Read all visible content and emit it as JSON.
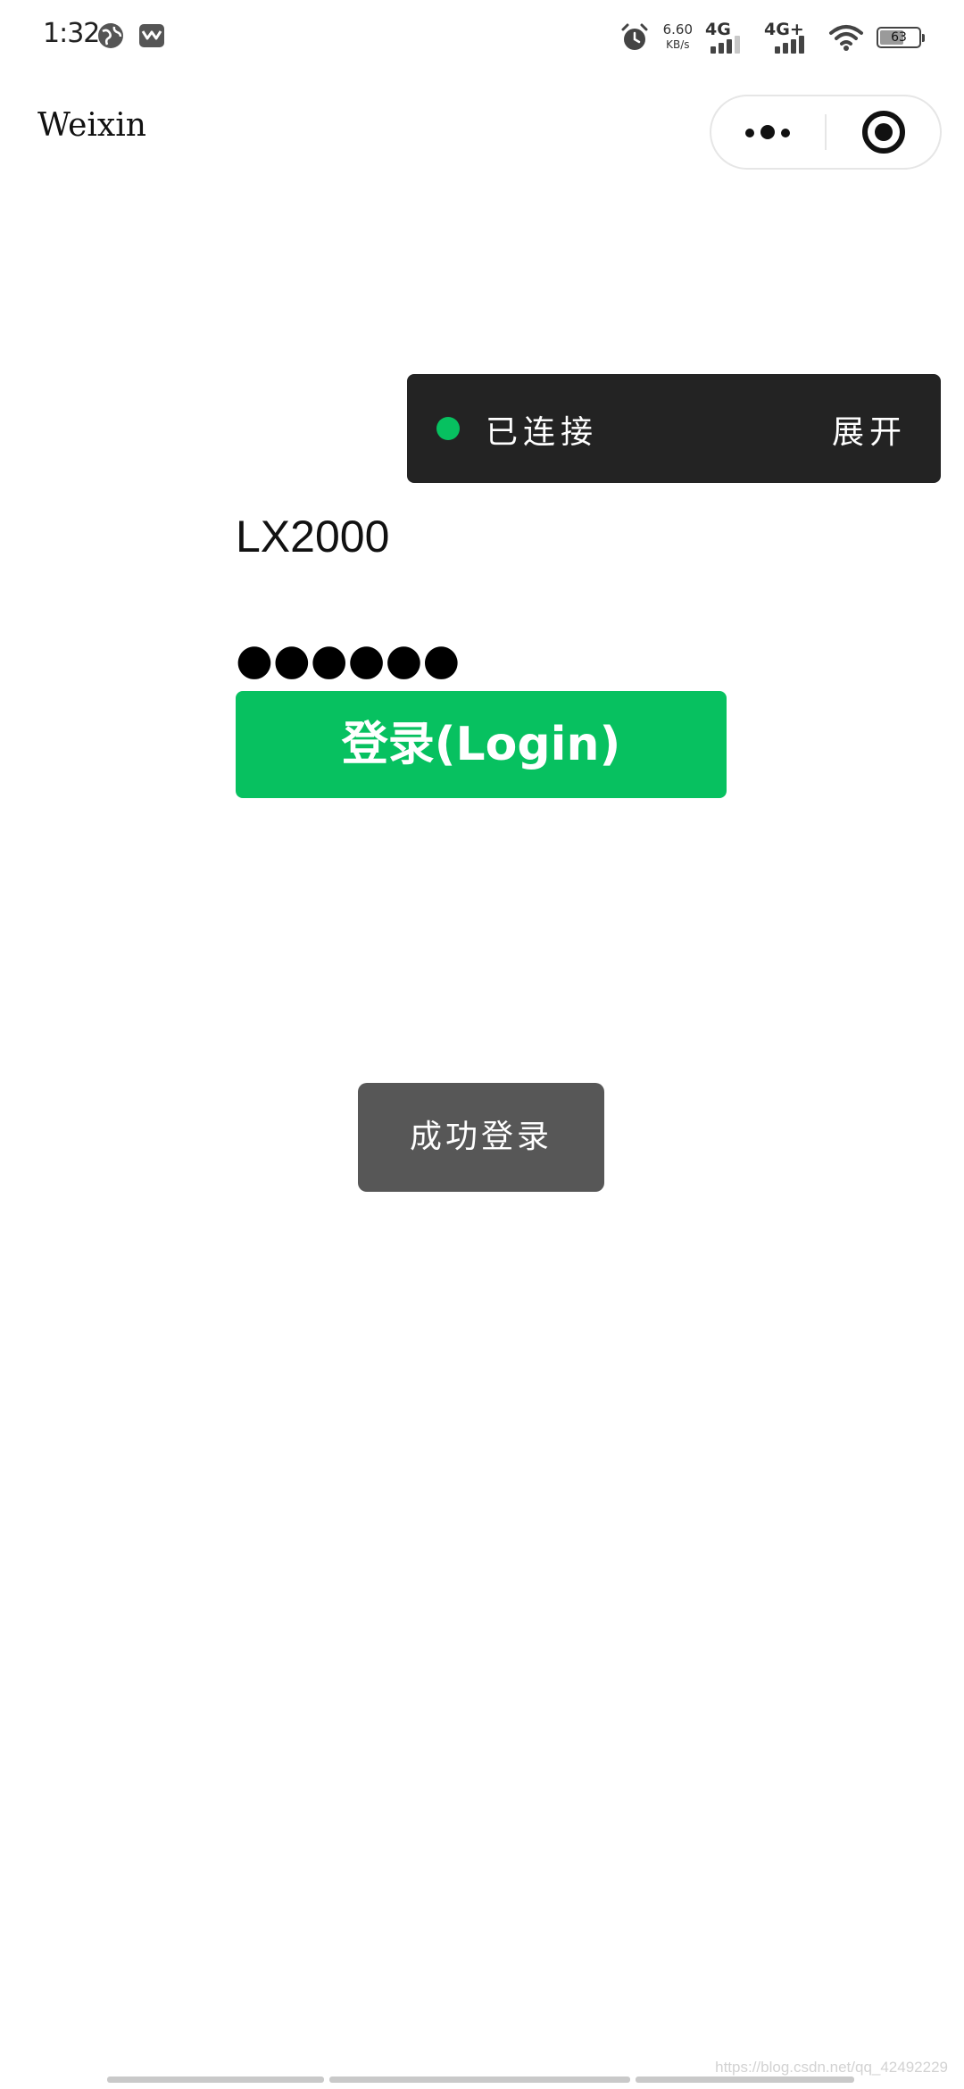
{
  "status_bar": {
    "time": "1:32",
    "app_icons": [
      "globe-icon",
      "mail-icon"
    ],
    "net_speed_value": "6.60",
    "net_speed_unit": "KB/s",
    "signal_1_label": "4G",
    "signal_2_label": "4G+",
    "battery_percent": "63",
    "battery_level": 0.63,
    "icons": [
      "alarm-icon",
      "signal-icon",
      "wifi-icon",
      "battery-icon"
    ]
  },
  "nav": {
    "title": "Weixin",
    "more_icon": "more-dots-icon",
    "close_icon": "mini-program-close-icon"
  },
  "connection": {
    "status": "已连接",
    "expand_label": "展开",
    "dot_color": "#07c160"
  },
  "form": {
    "username": "LX2000",
    "password_mask": "●●●●●●",
    "login_label": "登录(Login)",
    "login_color": "#07c160"
  },
  "toast": {
    "message": "成功登录"
  },
  "watermark": "https://blog.csdn.net/qq_42492229"
}
